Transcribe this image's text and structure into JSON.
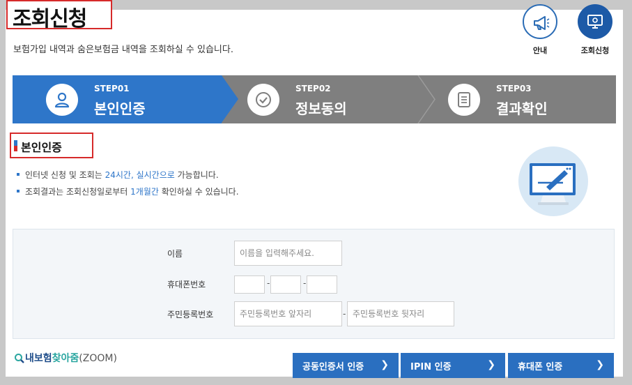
{
  "header": {
    "title": "조회신청",
    "subtitle": "보험가입 내역과 숨은보험금 내역을 조회하실 수 있습니다."
  },
  "top_nav": {
    "guide_label": "안내",
    "inquiry_label": "조회신청"
  },
  "steps": [
    {
      "num": "STEP01",
      "name": "본인인증",
      "icon": "person-icon",
      "active": true
    },
    {
      "num": "STEP02",
      "name": "정보동의",
      "icon": "check-icon",
      "active": false
    },
    {
      "num": "STEP03",
      "name": "결과확인",
      "icon": "document-icon",
      "active": false
    }
  ],
  "section": {
    "title": "본인인증",
    "note1_a": "인터넷 신청 및 조회는 ",
    "note1_hl": "24시간, 실시간으로",
    "note1_b": " 가능합니다.",
    "note2_a": "조회결과는 조회신청일로부터 ",
    "note2_hl": "1개월간",
    "note2_b": " 확인하실 수 있습니다."
  },
  "form": {
    "name_label": "이름",
    "name_placeholder": "이름을 입력해주세요.",
    "phone_label": "휴대폰번호",
    "phone_sep": "-",
    "rrn_label": "주민등록번호",
    "rrn_front_placeholder": "주민등록번호 앞자리",
    "rrn_back_placeholder": "주민등록번호 뒷자리",
    "rrn_sep": "-"
  },
  "zoom": {
    "part1": "내보험",
    "part2": "찾아줌",
    "part3": "(ZOOM)"
  },
  "auth_buttons": {
    "cert": "공동인증서 인증",
    "ipin": "IPIN 인증",
    "phone": "휴대폰 인증",
    "chevron": "❯"
  },
  "colors": {
    "accent": "#2e76c9",
    "highlight_border": "#d62a2a",
    "step_inactive": "#7f7f7f"
  }
}
